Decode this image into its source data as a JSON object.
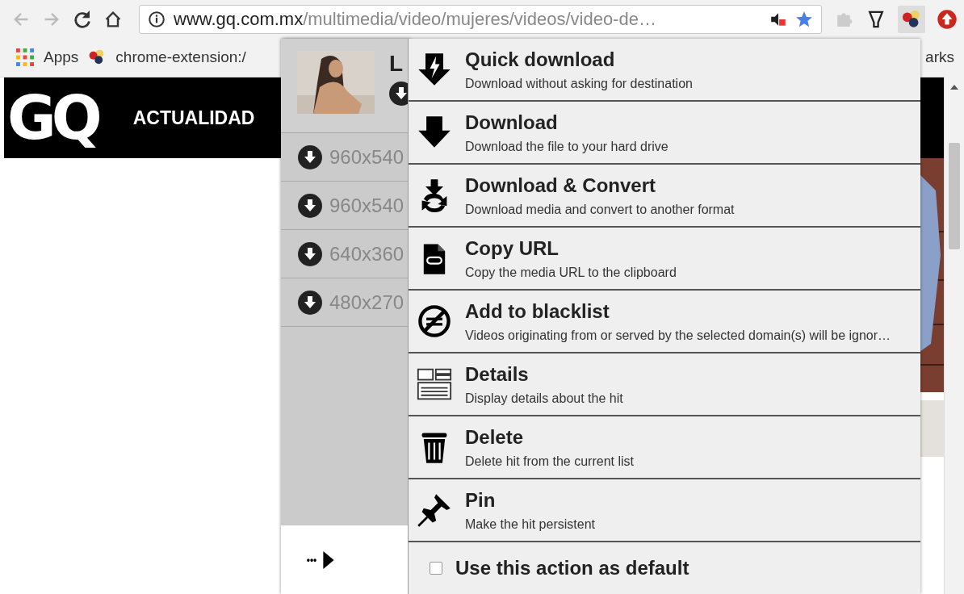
{
  "toolbar": {
    "back_disabled": true,
    "forward_disabled": true,
    "url_host": "www.gq.com.mx",
    "url_path": "/multimedia/video/mujeres/videos/video-de…"
  },
  "bookmarks": [
    "Apps",
    "chrome-extension:/",
    "arks"
  ],
  "page": {
    "logo": "GQ",
    "nav": "ACTUALIDAD"
  },
  "hits_panel": {
    "title": "L",
    "variants": [
      {
        "label": "960x540"
      },
      {
        "label": "960x540"
      },
      {
        "label": "640x360"
      },
      {
        "label": "480x270"
      }
    ],
    "more": "•••"
  },
  "actions": [
    {
      "kind": "quick",
      "title": "Quick download",
      "description": "Download without asking for destination"
    },
    {
      "kind": "download",
      "title": "Download",
      "description": "Download the file to your hard drive"
    },
    {
      "kind": "convert",
      "title": "Download & Convert",
      "description": "Download media and convert to another format"
    },
    {
      "kind": "copy",
      "title": "Copy URL",
      "description": "Copy the media URL to the clipboard"
    },
    {
      "kind": "blacklist",
      "title": "Add to blacklist",
      "description": "Videos originating from or served by the selected domain(s) will be ignor…"
    },
    {
      "kind": "details",
      "title": "Details",
      "description": "Display details about the hit"
    },
    {
      "kind": "delete",
      "title": "Delete",
      "description": "Delete hit from the current list"
    },
    {
      "kind": "pin",
      "title": "Pin",
      "description": "Make the hit persistent"
    }
  ],
  "default_option": {
    "label": "Use this action as default",
    "checked": false
  }
}
